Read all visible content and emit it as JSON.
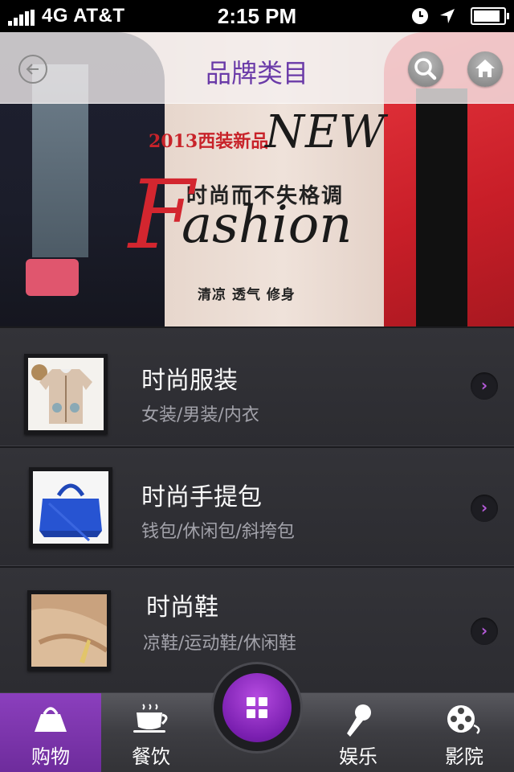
{
  "status_bar": {
    "carrier": "4G AT&T",
    "time": "2:15 PM",
    "battery_level": 0.9,
    "icons": [
      "signal-icon",
      "clock-icon",
      "location-arrow-icon",
      "battery-icon"
    ]
  },
  "header": {
    "title": "品牌类目",
    "back_icon": "back-arrow-icon",
    "search_icon": "search-icon",
    "home_icon": "home-icon"
  },
  "banner": {
    "year_text": "2013西装新品",
    "new_text": "NEW",
    "slogan": "时尚而不失格调",
    "f_letter": "F",
    "fashion_rest": "ashion",
    "tagline": "清凉 透气 修身",
    "slides": 4,
    "active_slide": 1
  },
  "categories": [
    {
      "title": "时尚服装",
      "subtitle": "女装/男装/内衣"
    },
    {
      "title": "时尚手提包",
      "subtitle": "钱包/休闲包/斜挎包"
    },
    {
      "title": "时尚鞋",
      "subtitle": "凉鞋/运动鞋/休闲鞋"
    }
  ],
  "tabbar": {
    "tabs": [
      {
        "label": "购物",
        "icon": "shopping-bag-icon",
        "active": true
      },
      {
        "label": "餐饮",
        "icon": "coffee-cup-icon",
        "active": false
      },
      {
        "label": "娱乐",
        "icon": "microphone-icon",
        "active": false
      },
      {
        "label": "影院",
        "icon": "film-reel-icon",
        "active": false
      }
    ],
    "center_icon": "grid-menu-icon"
  },
  "colors": {
    "accent_purple": "#7a2fb0",
    "title_purple": "#6a3aa8",
    "banner_red": "#d3262f"
  }
}
